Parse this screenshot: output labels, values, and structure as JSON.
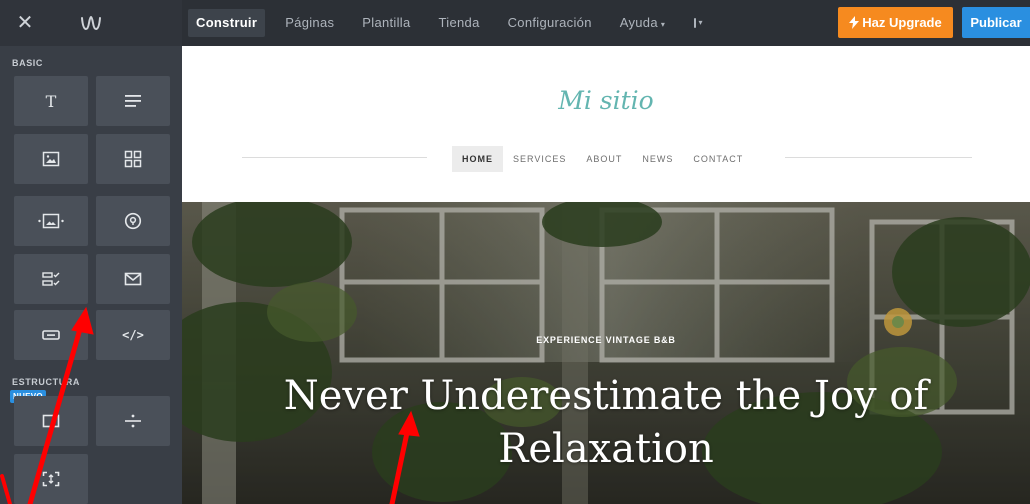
{
  "topbar": {
    "close_label": "✕",
    "nav": [
      {
        "label": "Construir",
        "active": true
      },
      {
        "label": "Páginas"
      },
      {
        "label": "Plantilla"
      },
      {
        "label": "Tienda"
      },
      {
        "label": "Configuración"
      },
      {
        "label": "Ayuda"
      }
    ],
    "upgrade_label": "Haz Upgrade",
    "publish_label": "Publicar"
  },
  "sidebar": {
    "basic_label": "BASIC",
    "structure_label": "ESTRUCTURA",
    "new_badge": "NUEVO",
    "basic_tiles": [
      "title-icon",
      "text-icon",
      "image-icon",
      "gallery-icon",
      "slideshow-icon",
      "map-icon",
      "form-icon",
      "contact-form-icon",
      "button-icon",
      "embed-code-icon"
    ],
    "embed_glyph": "</>",
    "structure_tiles": [
      "section-icon",
      "divider-icon",
      "spacer-icon"
    ]
  },
  "site": {
    "title": "Mi sitio",
    "nav": [
      "HOME",
      "SERVICES",
      "ABOUT",
      "NEWS",
      "CONTACT"
    ],
    "hero_kicker": "EXPERIENCE VINTAGE B&B",
    "hero_heading": "Never Underestimate the Joy of Relaxation"
  },
  "colors": {
    "topbar": "#2c3036",
    "sidebar": "#393e46",
    "tile": "#4a5059",
    "upgrade": "#f68a1f",
    "publish": "#2a8fe0",
    "brand_teal": "#63b5b0",
    "annotation_arrow": "#ff0000"
  }
}
